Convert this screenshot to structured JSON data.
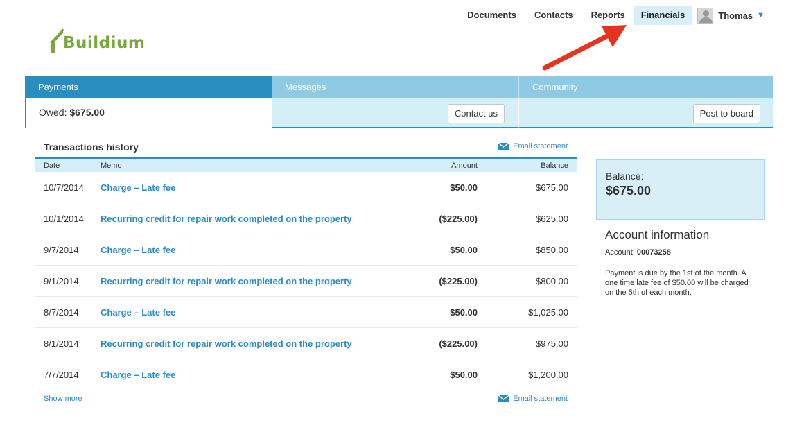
{
  "brand": {
    "name": "Buildium",
    "color": "#7aa83a"
  },
  "nav": {
    "items": [
      {
        "label": "Documents"
      },
      {
        "label": "Contacts"
      },
      {
        "label": "Reports"
      },
      {
        "label": "Financials",
        "active": true
      }
    ],
    "user": "Thomas",
    "caret": "▼"
  },
  "panels": {
    "payments": {
      "title": "Payments",
      "owed_label": "Owed:",
      "owed_value": "$675.00"
    },
    "messages": {
      "title": "Messages",
      "button": "Contact us"
    },
    "community": {
      "title": "Community",
      "button": "Post to board"
    }
  },
  "transactions": {
    "title": "Transactions history",
    "email_label": "Email statement",
    "show_more": "Show more",
    "columns": {
      "date": "Date",
      "memo": "Memo",
      "amount": "Amount",
      "balance": "Balance"
    },
    "rows": [
      {
        "date": "10/7/2014",
        "memo": "Charge – Late fee",
        "amount": "$50.00",
        "balance": "$675.00"
      },
      {
        "date": "10/1/2014",
        "memo": "Recurring credit for repair work completed on the property",
        "amount": "($225.00)",
        "balance": "$625.00"
      },
      {
        "date": "9/7/2014",
        "memo": "Charge – Late fee",
        "amount": "$50.00",
        "balance": "$850.00"
      },
      {
        "date": "9/1/2014",
        "memo": "Recurring credit for repair work completed on the property",
        "amount": "($225.00)",
        "balance": "$800.00"
      },
      {
        "date": "8/7/2014",
        "memo": "Charge – Late fee",
        "amount": "$50.00",
        "balance": "$1,025.00"
      },
      {
        "date": "8/1/2014",
        "memo": "Recurring credit for repair work completed on the property",
        "amount": "($225.00)",
        "balance": "$975.00"
      },
      {
        "date": "7/7/2014",
        "memo": "Charge – Late fee",
        "amount": "$50.00",
        "balance": "$1,200.00"
      }
    ]
  },
  "sidebar": {
    "balance_label": "Balance:",
    "balance_value": "$675.00",
    "account_title": "Account information",
    "account_label": "Account:",
    "account_number": "00073258",
    "note": "Payment is due by the 1st of the month. A one time late fee of $50.00 will be charged on the 5th of each month."
  },
  "colors": {
    "accent": "#2a8cc4",
    "panel_active": "#2a8dbf",
    "panel_inactive": "#8ecae3",
    "panel_body": "#d4eff7",
    "annotation_arrow": "#e8321e"
  },
  "icons": {
    "logo": "house-roof-icon",
    "email": "envelope-icon",
    "avatar": "user-silhouette-icon",
    "annotation": "red-arrow-icon"
  }
}
